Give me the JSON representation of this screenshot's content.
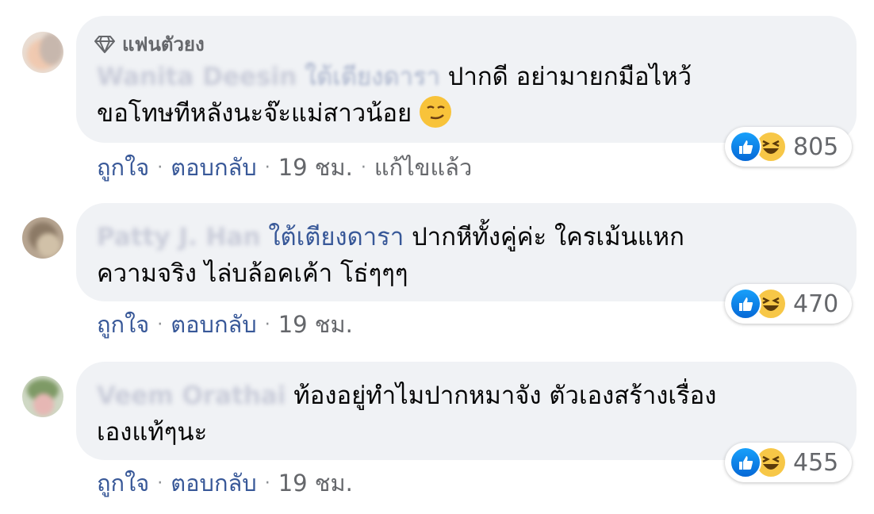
{
  "comments": [
    {
      "badge": "แฟนตัวยง",
      "author": "Wanita Deesin",
      "tag": "ใต้เตียงดารา",
      "text_line1": "ปากดี อย่ามายกมือไหว้",
      "text_line2": "ขอโทษทีหลังนะจ๊ะแม่สาวน้อย",
      "actions": {
        "like": "ถูกใจ",
        "reply": "ตอบกลับ",
        "time": "19 ชม.",
        "edited": "แก้ไขแล้ว"
      },
      "reaction_count": "805",
      "reaction_icons": [
        "like-icon",
        "haha-icon"
      ]
    },
    {
      "author": "Patty J. Han",
      "tag": "ใต้เตียงดารา",
      "text_line1": "ปากหีทั้งคู่ค่ะ ใครเม้นแหก",
      "text_line2": "ความจริง ไล่บล้อคเค้า โธ่ๆๆๆ",
      "actions": {
        "like": "ถูกใจ",
        "reply": "ตอบกลับ",
        "time": "19 ชม."
      },
      "reaction_count": "470",
      "reaction_icons": [
        "like-icon",
        "haha-icon"
      ]
    },
    {
      "author": "Veem Orathai",
      "text_line1": "ท้องอยู่ทำไมปากหมาจัง ตัวเองสร้างเรื่อง",
      "text_line2": "เองแท้ๆนะ",
      "actions": {
        "like": "ถูกใจ",
        "reply": "ตอบกลับ",
        "time": "19 ชม."
      },
      "reaction_count": "455",
      "reaction_icons": [
        "like-icon",
        "haha-icon"
      ]
    }
  ],
  "separator": "·",
  "colors": {
    "link": "#385898",
    "bubble": "#f0f2f5",
    "meta": "#65676b"
  }
}
